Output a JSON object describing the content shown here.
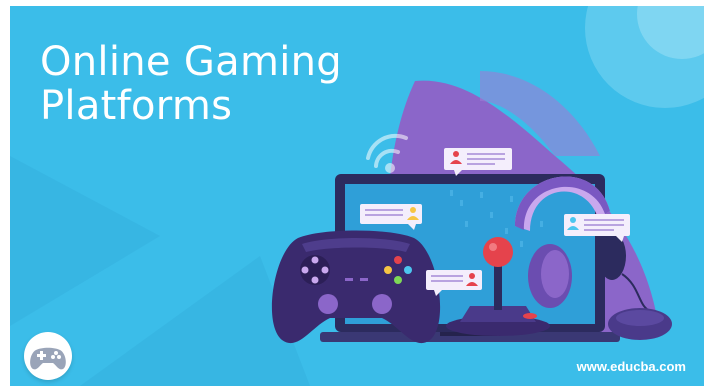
{
  "banner": {
    "title_line1": "Online Gaming",
    "title_line2": "Platforms",
    "site_url": "www.educba.com"
  },
  "colors": {
    "background": "#3bbde9",
    "purple_shape": "#8b66c9",
    "controller": "#3a2a6e",
    "laptop_body": "#2c2b5e",
    "screen": "#2f9fd8",
    "joystick_ball": "#e5434c",
    "headphones": "#7a58c2"
  },
  "icons": [
    "gamepad-icon",
    "headphones-icon",
    "joystick-icon",
    "mouse-icon",
    "chat-bubble-icon",
    "user-icon",
    "wifi-icon"
  ]
}
